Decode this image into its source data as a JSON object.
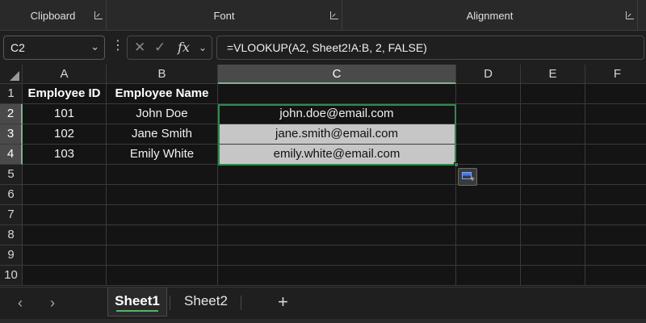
{
  "ribbon": {
    "groups": [
      {
        "label": "Clipboard"
      },
      {
        "label": "Font"
      },
      {
        "label": "Alignment"
      }
    ]
  },
  "formula_bar": {
    "name_box": "C2",
    "formula": "=VLOOKUP(A2, Sheet2!A:B, 2, FALSE)",
    "icons": {
      "cancel": "✕",
      "enter": "✓",
      "fx": "fx"
    }
  },
  "grid": {
    "columns": [
      "A",
      "B",
      "C",
      "D",
      "E",
      "F"
    ],
    "rows": [
      "1",
      "2",
      "3",
      "4",
      "5",
      "6",
      "7",
      "8",
      "9",
      "10"
    ],
    "cells": {
      "A1": "Employee ID",
      "B1": "Employee Name",
      "A2": "101",
      "B2": "John Doe",
      "C2": "john.doe@email.com",
      "A3": "102",
      "B3": "Jane Smith",
      "C3": "jane.smith@email.com",
      "A4": "103",
      "B4": "Emily White",
      "C4": "emily.white@email.com"
    },
    "active_cell": "C2",
    "selection": "C2:C4"
  },
  "sheet_tabs": {
    "tabs": [
      {
        "label": "Sheet1",
        "active": true
      },
      {
        "label": "Sheet2",
        "active": false
      }
    ],
    "add_label": "+"
  },
  "colors": {
    "selection_border": "#2f8a4f",
    "active_tab_underline": "#57b36b"
  }
}
